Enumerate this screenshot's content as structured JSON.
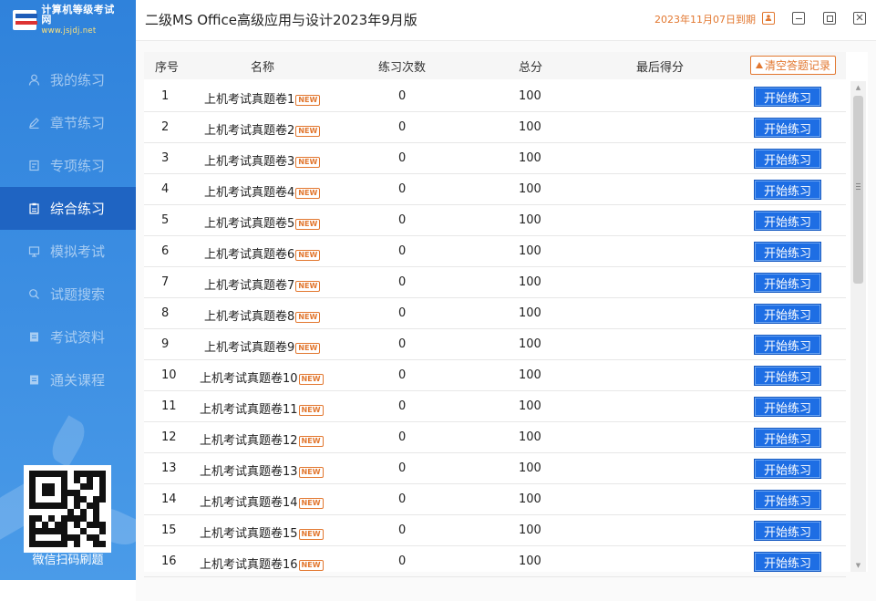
{
  "sidebar": {
    "logo_title": "计算机等级考试网",
    "logo_url": "www.jsjdj.net",
    "items": [
      {
        "label": "我的练习",
        "icon": "user-icon",
        "active": false
      },
      {
        "label": "章节练习",
        "icon": "pencil-icon",
        "active": false
      },
      {
        "label": "专项练习",
        "icon": "document-icon",
        "active": false
      },
      {
        "label": "综合练习",
        "icon": "clipboard-icon",
        "active": true
      },
      {
        "label": "模拟考试",
        "icon": "monitor-icon",
        "active": false
      },
      {
        "label": "试题搜索",
        "icon": "search-icon",
        "active": false
      },
      {
        "label": "考试资料",
        "icon": "file-icon",
        "active": false
      },
      {
        "label": "通关课程",
        "icon": "book-icon",
        "active": false
      }
    ],
    "qr_caption": "微信扫码刷题"
  },
  "header": {
    "title": "二级MS Office高级应用与设计2023年9月版",
    "expire_text": "2023年11月07日到期"
  },
  "table": {
    "columns": {
      "index": "序号",
      "name": "名称",
      "practice_count": "练习次数",
      "total_score": "总分",
      "last_score": "最后得分"
    },
    "clear_button": "清空答题记录",
    "badge": "NEW",
    "action_label": "开始练习",
    "rows": [
      {
        "index": "1",
        "name": "上机考试真题卷1",
        "count": "0",
        "total": "100",
        "last": ""
      },
      {
        "index": "2",
        "name": "上机考试真题卷2",
        "count": "0",
        "total": "100",
        "last": ""
      },
      {
        "index": "3",
        "name": "上机考试真题卷3",
        "count": "0",
        "total": "100",
        "last": ""
      },
      {
        "index": "4",
        "name": "上机考试真题卷4",
        "count": "0",
        "total": "100",
        "last": ""
      },
      {
        "index": "5",
        "name": "上机考试真题卷5",
        "count": "0",
        "total": "100",
        "last": ""
      },
      {
        "index": "6",
        "name": "上机考试真题卷6",
        "count": "0",
        "total": "100",
        "last": ""
      },
      {
        "index": "7",
        "name": "上机考试真题卷7",
        "count": "0",
        "total": "100",
        "last": ""
      },
      {
        "index": "8",
        "name": "上机考试真题卷8",
        "count": "0",
        "total": "100",
        "last": ""
      },
      {
        "index": "9",
        "name": "上机考试真题卷9",
        "count": "0",
        "total": "100",
        "last": ""
      },
      {
        "index": "10",
        "name": "上机考试真题卷10",
        "count": "0",
        "total": "100",
        "last": ""
      },
      {
        "index": "11",
        "name": "上机考试真题卷11",
        "count": "0",
        "total": "100",
        "last": ""
      },
      {
        "index": "12",
        "name": "上机考试真题卷12",
        "count": "0",
        "total": "100",
        "last": ""
      },
      {
        "index": "13",
        "name": "上机考试真题卷13",
        "count": "0",
        "total": "100",
        "last": ""
      },
      {
        "index": "14",
        "name": "上机考试真题卷14",
        "count": "0",
        "total": "100",
        "last": ""
      },
      {
        "index": "15",
        "name": "上机考试真题卷15",
        "count": "0",
        "total": "100",
        "last": ""
      },
      {
        "index": "16",
        "name": "上机考试真题卷16",
        "count": "0",
        "total": "100",
        "last": ""
      }
    ]
  },
  "colors": {
    "sidebar": "#2f82db",
    "sidebar_active": "#1f64c2",
    "accent_orange": "#e2772f",
    "primary_button": "#1e6ee4"
  }
}
